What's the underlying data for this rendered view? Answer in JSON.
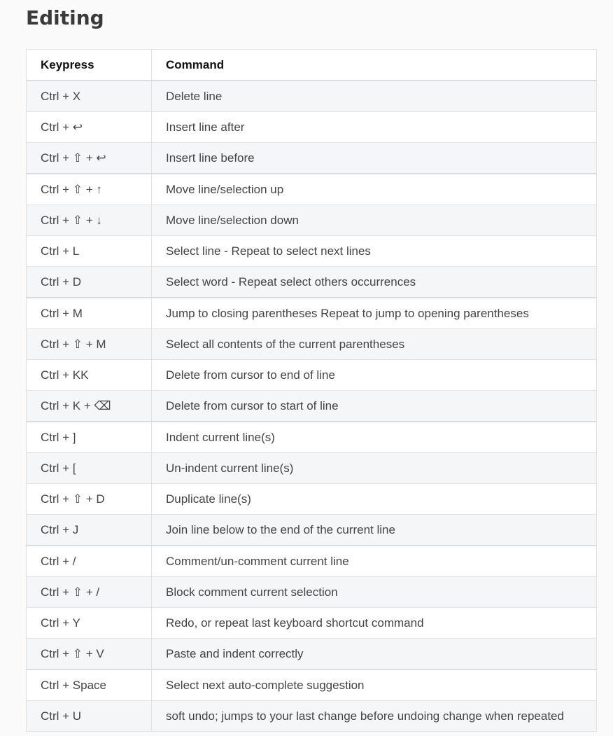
{
  "section_title": "Editing",
  "table": {
    "headers": [
      "Keypress",
      "Command"
    ],
    "rows": [
      {
        "keypress": "Ctrl + X",
        "command": "Delete line"
      },
      {
        "keypress": "Ctrl + ↩",
        "command": "Insert line after"
      },
      {
        "keypress": "Ctrl + ⇧ + ↩",
        "command": "Insert line before"
      },
      {
        "keypress": "Ctrl + ⇧ + ↑",
        "command": "Move line/selection up"
      },
      {
        "keypress": "Ctrl + ⇧ + ↓",
        "command": "Move line/selection down"
      },
      {
        "keypress": "Ctrl + L",
        "command": "Select line - Repeat to select next lines"
      },
      {
        "keypress": "Ctrl + D",
        "command": "Select word - Repeat select others occurrences"
      },
      {
        "keypress": "Ctrl + M",
        "command": "Jump to closing parentheses Repeat to jump to opening parentheses"
      },
      {
        "keypress": "Ctrl + ⇧ + M",
        "command": "Select all contents of the current parentheses"
      },
      {
        "keypress": "Ctrl + KK",
        "command": "Delete from cursor to end of line"
      },
      {
        "keypress": "Ctrl + K + ⌫",
        "command": "Delete from cursor to start of line"
      },
      {
        "keypress": "Ctrl + ]",
        "command": "Indent current line(s)"
      },
      {
        "keypress": "Ctrl + [",
        "command": "Un-indent current line(s)"
      },
      {
        "keypress": "Ctrl + ⇧ + D",
        "command": "Duplicate line(s)"
      },
      {
        "keypress": "Ctrl + J",
        "command": "Join line below to the end of the current line"
      },
      {
        "keypress": "Ctrl + /",
        "command": "Comment/un-comment current line"
      },
      {
        "keypress": "Ctrl + ⇧ + /",
        "command": "Block comment current selection"
      },
      {
        "keypress": "Ctrl + Y",
        "command": "Redo, or repeat last keyboard shortcut command"
      },
      {
        "keypress": "Ctrl + ⇧ + V",
        "command": "Paste and indent correctly"
      },
      {
        "keypress": "Ctrl + Space",
        "command": "Select next auto-complete suggestion"
      },
      {
        "keypress": "Ctrl + U",
        "command": "soft undo; jumps to your last change before undoing change when repeated"
      }
    ]
  }
}
